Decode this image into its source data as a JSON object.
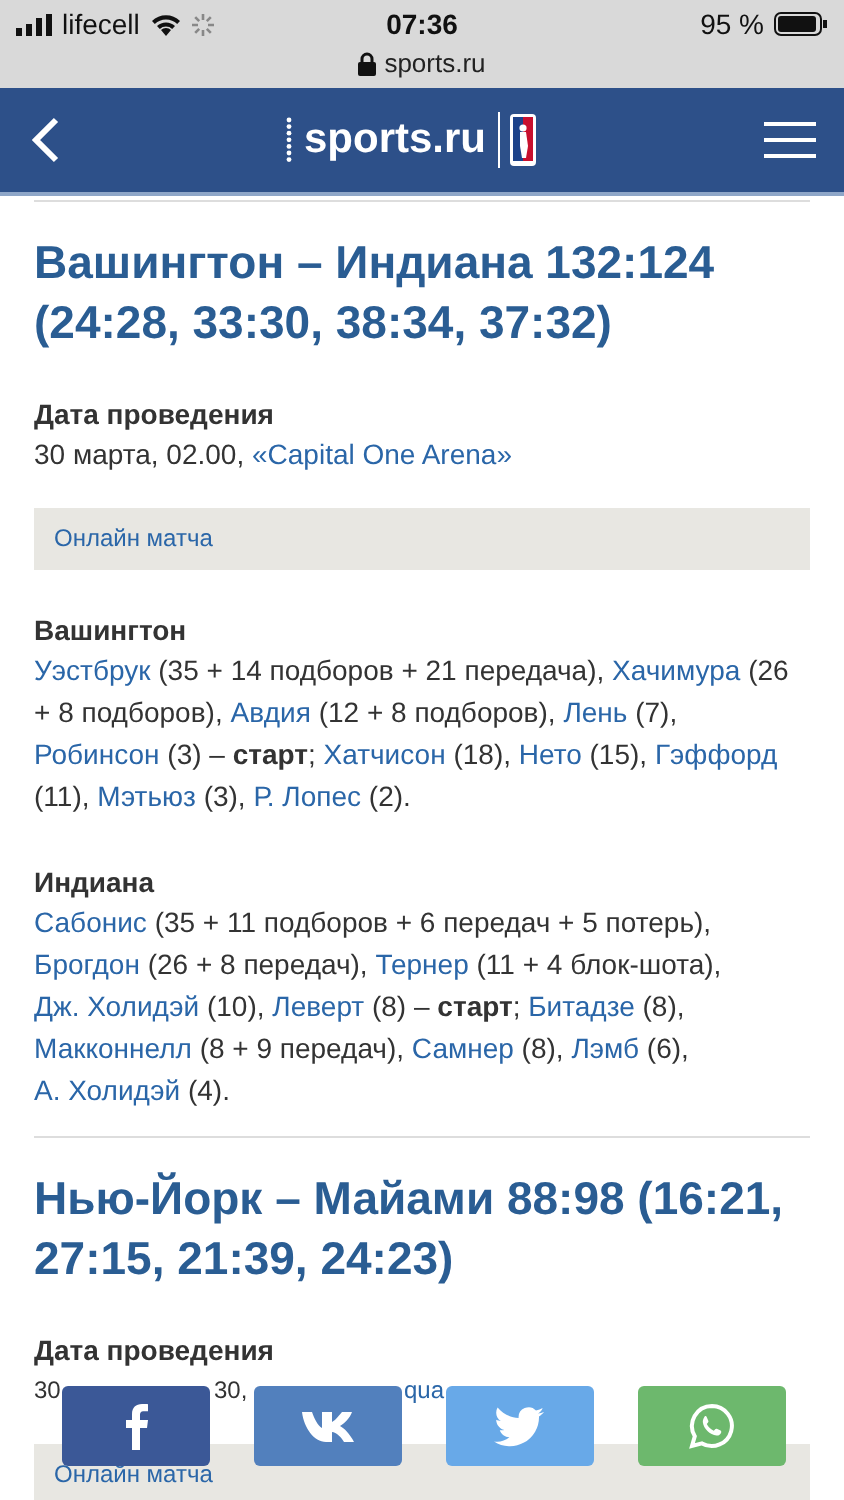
{
  "status_bar": {
    "carrier": "lifecell",
    "time": "07:36",
    "battery": "95 %",
    "url": "sports.ru"
  },
  "header": {
    "logo": "sports.ru"
  },
  "matches": [
    {
      "title": "Вашингтон – Индиана 132:124 (24:28, 33:30, 38:34, 37:32)",
      "date_label": "Дата проведения",
      "date": "30 марта, 02.00,",
      "venue": "«Capital One Arena»",
      "online": "Онлайн матча",
      "teams": [
        {
          "name": "Вашингтон",
          "segments": [
            {
              "kind": "link",
              "text": "Уэстбрук"
            },
            {
              "kind": "text",
              "text": "(35 + 14 подборов + 21 передача),"
            },
            {
              "kind": "link",
              "text": "Хачимура"
            },
            {
              "kind": "text",
              "text": "(26 + 8 подборов),"
            },
            {
              "kind": "link",
              "text": "Авдия"
            },
            {
              "kind": "text",
              "text": "(12 + 8 подборов),"
            },
            {
              "kind": "link",
              "text": "Лень"
            },
            {
              "kind": "text",
              "text": "(7),"
            },
            {
              "kind": "link",
              "text": "Робинсон"
            },
            {
              "kind": "text",
              "text": "(3) – **старт**;"
            },
            {
              "kind": "link",
              "text": "Хатчисон"
            },
            {
              "kind": "text",
              "text": "(18),"
            },
            {
              "kind": "link",
              "text": "Нето"
            },
            {
              "kind": "text",
              "text": "(15),"
            },
            {
              "kind": "link",
              "text": "Гэффорд"
            },
            {
              "kind": "text",
              "text": "(11),"
            },
            {
              "kind": "link",
              "text": "Мэтьюз"
            },
            {
              "kind": "text",
              "text": "(3),"
            },
            {
              "kind": "link",
              "text": "Р. Лопес"
            },
            {
              "kind": "text",
              "text": "(2)."
            }
          ]
        },
        {
          "name": "Индиана",
          "segments": [
            {
              "kind": "link",
              "text": "Сабонис"
            },
            {
              "kind": "text",
              "text": "(35 + 11 подборов + 6 передач + 5 потерь),"
            },
            {
              "kind": "link",
              "text": "Брогдон"
            },
            {
              "kind": "text",
              "text": "(26 + 8 передач),"
            },
            {
              "kind": "link",
              "text": "Тернер"
            },
            {
              "kind": "text",
              "text": "(11 + 4 блок-шота),"
            },
            {
              "kind": "link",
              "text": "Дж. Холидэй"
            },
            {
              "kind": "text",
              "text": "(10),"
            },
            {
              "kind": "link",
              "text": "Леверт"
            },
            {
              "kind": "text",
              "text": "(8) – **старт**;"
            },
            {
              "kind": "link",
              "text": "Битадзе"
            },
            {
              "kind": "text",
              "text": "(8),"
            },
            {
              "kind": "link",
              "text": "Макконнелл"
            },
            {
              "kind": "text",
              "text": "(8 + 9 передач),"
            },
            {
              "kind": "link",
              "text": "Самнер"
            },
            {
              "kind": "text",
              "text": "(8),"
            },
            {
              "kind": "link",
              "text": "Лэмб"
            },
            {
              "kind": "text",
              "text": "(6),"
            },
            {
              "kind": "link",
              "text": "А. Холидэй"
            },
            {
              "kind": "text",
              "text": "(4)."
            }
          ]
        }
      ]
    },
    {
      "title": "Нью-Йорк – Майами 88:98 (16:21, 27:15, 21:39, 24:23)",
      "date_label": "Дата проведения",
      "date_fragments": [
        {
          "kind": "text",
          "text": "30"
        },
        {
          "kind": "text",
          "text": "30,"
        },
        {
          "kind": "link",
          "text": "qua"
        }
      ],
      "online": "Онлайн матча"
    }
  ],
  "share": [
    {
      "kind": "facebook"
    },
    {
      "kind": "vk"
    },
    {
      "kind": "twitter"
    },
    {
      "kind": "whatsapp"
    }
  ]
}
